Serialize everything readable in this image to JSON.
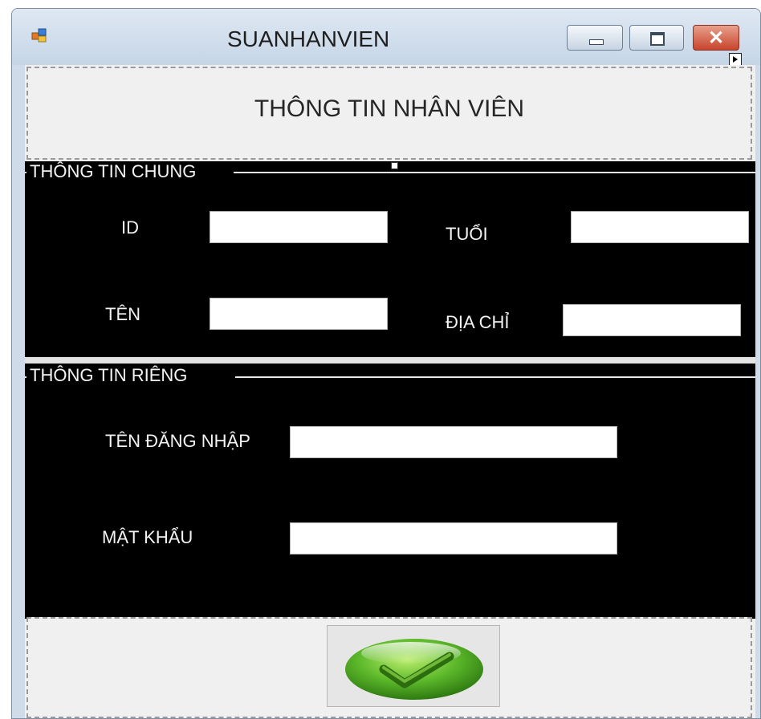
{
  "window": {
    "title": "SUANHANVIEN",
    "icon": "app-form-icon",
    "controls": {
      "minimize": "minimize-icon",
      "maximize": "maximize-icon",
      "close": "close-icon",
      "close_glyph": "✕"
    }
  },
  "header": {
    "title": "THÔNG TIN NHÂN VIÊN"
  },
  "general_group": {
    "title": "THÔNG TIN CHUNG",
    "id_label": "ID",
    "age_label": "TUỔI",
    "name_label": "TÊN",
    "address_label": "ĐỊA CHỈ",
    "id_value": "",
    "age_value": "",
    "name_value": "",
    "address_value": ""
  },
  "private_group": {
    "title": "THÔNG TIN RIÊNG",
    "username_label": "TÊN ĐĂNG NHẬP",
    "password_label": "MẬT KHẨU",
    "username_value": "",
    "password_value": ""
  },
  "footer": {
    "confirm_icon": "green-check-icon"
  },
  "colors": {
    "group_background": "#000000",
    "label_text": "#f3f3f3",
    "form_background": "#f0f0f0",
    "title_bar": "#cfdbe8",
    "close_button": "#c7442c",
    "check_green": "#5cb82a"
  }
}
